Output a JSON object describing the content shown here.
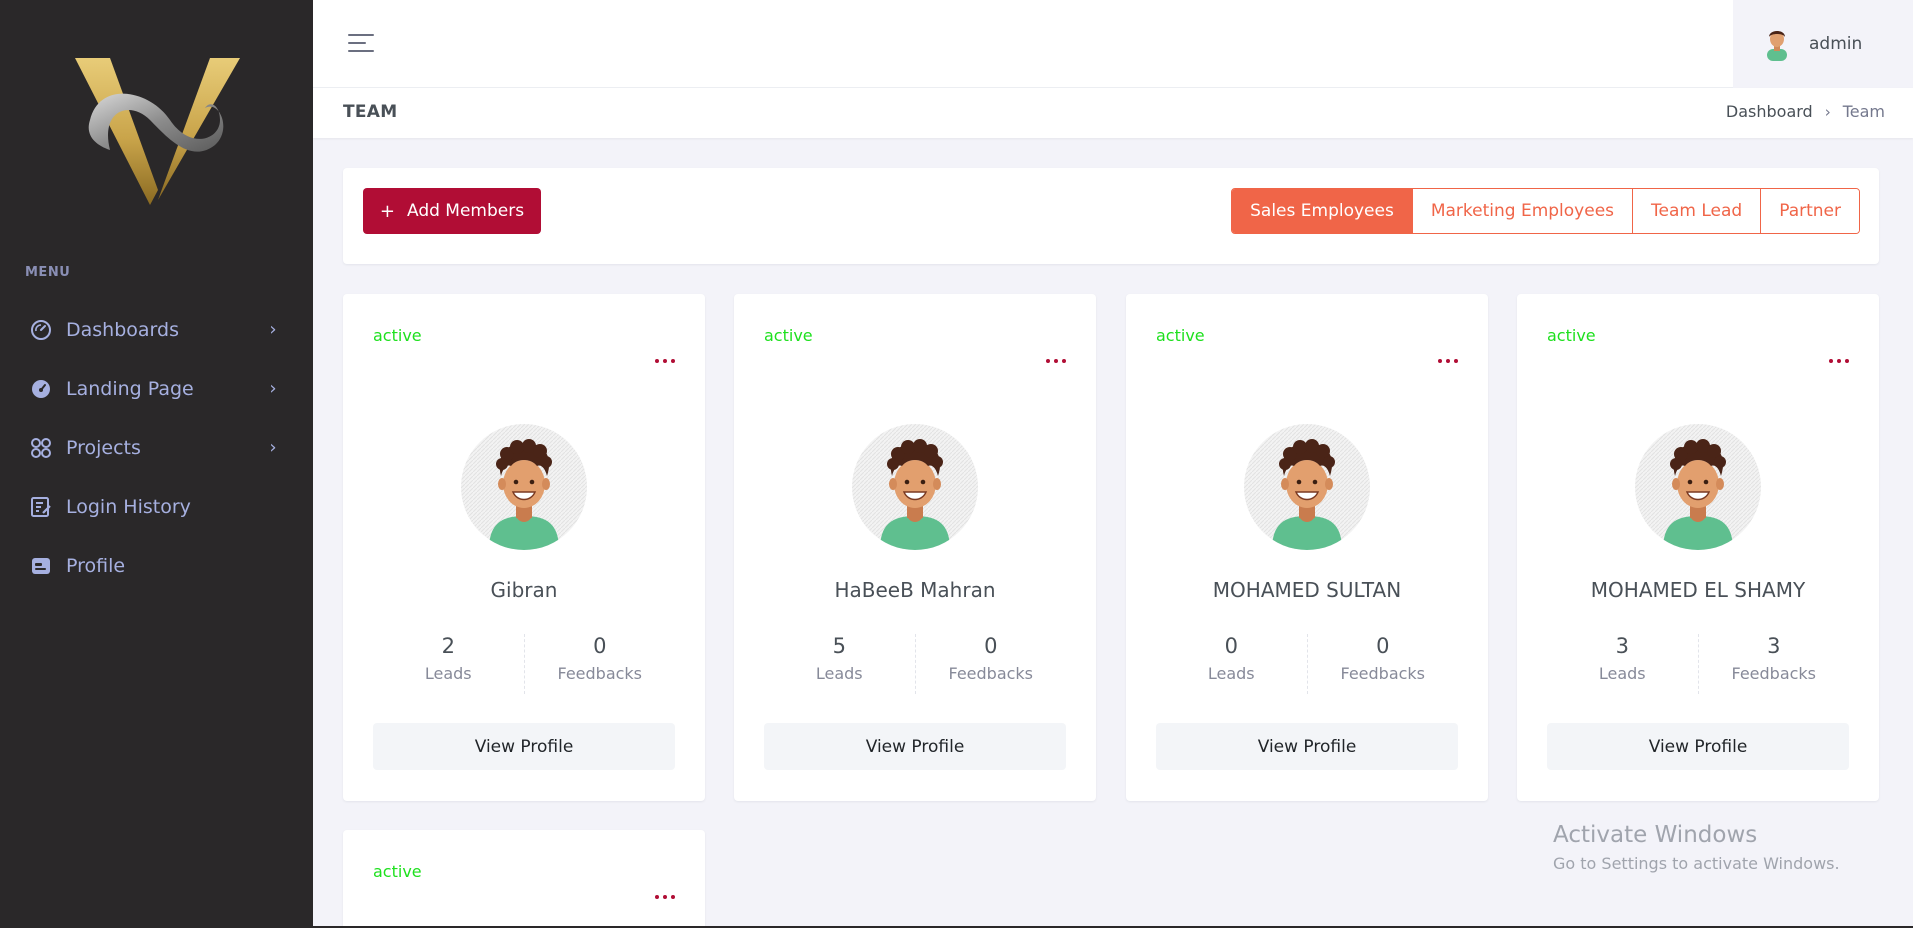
{
  "sidebar": {
    "menu_title": "MENU",
    "items": [
      {
        "label": "Dashboards",
        "icon": "gauge-icon",
        "has_children": true
      },
      {
        "label": "Landing Page",
        "icon": "landing-gauge-icon",
        "has_children": true
      },
      {
        "label": "Projects",
        "icon": "apps-icon",
        "has_children": true
      },
      {
        "label": "Login History",
        "icon": "edit-list-icon",
        "has_children": false
      },
      {
        "label": "Profile",
        "icon": "profile-card-icon",
        "has_children": false
      }
    ]
  },
  "topbar": {
    "user_name": "admin"
  },
  "titlebar": {
    "page_title": "TEAM",
    "breadcrumb": [
      "Dashboard",
      "Team"
    ]
  },
  "toolbar": {
    "add_button_label": "Add Members",
    "tabs": [
      {
        "label": "Sales Employees",
        "active": true
      },
      {
        "label": "Marketing Employees",
        "active": false
      },
      {
        "label": "Team Lead",
        "active": false
      },
      {
        "label": "Partner",
        "active": false
      }
    ]
  },
  "members": [
    {
      "status": "active",
      "name": "Gibran",
      "leads": "2",
      "feedbacks": "0",
      "leads_label": "Leads",
      "feedbacks_label": "Feedbacks",
      "button": "View Profile"
    },
    {
      "status": "active",
      "name": "HaBeeB Mahran",
      "leads": "5",
      "feedbacks": "0",
      "leads_label": "Leads",
      "feedbacks_label": "Feedbacks",
      "button": "View Profile"
    },
    {
      "status": "active",
      "name": "MOHAMED SULTAN",
      "leads": "0",
      "feedbacks": "0",
      "leads_label": "Leads",
      "feedbacks_label": "Feedbacks",
      "button": "View Profile"
    },
    {
      "status": "active",
      "name": "MOHAMED EL SHAMY",
      "leads": "3",
      "feedbacks": "3",
      "leads_label": "Leads",
      "feedbacks_label": "Feedbacks",
      "button": "View Profile"
    },
    {
      "status": "active"
    }
  ],
  "watermark": {
    "line1": "Activate Windows",
    "line2": "Go to Settings to activate Windows."
  },
  "colors": {
    "sidebar_bg": "#2a2829",
    "primary": "#b10d35",
    "accent": "#f06548",
    "active_status": "#1ee01e",
    "logo_gold": "#c9a44a"
  }
}
